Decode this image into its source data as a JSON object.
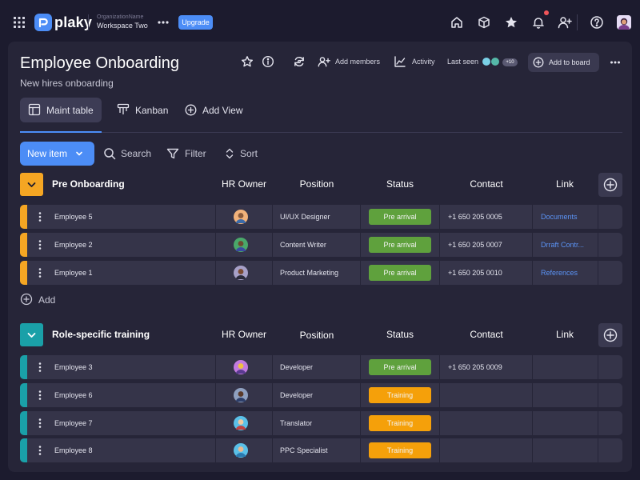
{
  "topbar": {
    "logo": "plaky",
    "organization": "OrganizationName",
    "workspace": "Workspace Two",
    "upgrade_label": "Upgrade",
    "icons": [
      "apps-grid-icon",
      "home-icon",
      "box-icon",
      "star-icon",
      "bell-icon",
      "add-user-icon",
      "help-icon"
    ]
  },
  "board": {
    "title": "Employee Onboarding",
    "subtitle": "New hires onboarding",
    "add_members_label": "Add members",
    "activity_label": "Activity",
    "last_seen_label": "Last seen",
    "last_seen_more": "+10",
    "add_to_board_label": "Add to board"
  },
  "tabs": [
    {
      "label": "Maint table",
      "active": true
    },
    {
      "label": "Kanban",
      "active": false
    },
    {
      "label": "Add View",
      "active": false
    }
  ],
  "toolbar": {
    "new_item_label": "New item",
    "search_label": "Search",
    "filter_label": "Filter",
    "sort_label": "Sort"
  },
  "columns": [
    "HR Owner",
    "Position",
    "Status",
    "Contact",
    "Link"
  ],
  "groups": [
    {
      "name": "Pre Onboarding",
      "color": "#f5a623",
      "add_label": "Add",
      "rows": [
        {
          "name": "Employee 5",
          "position": "UI/UX Designer",
          "status": "Pre arrival",
          "contact": "+1 650 205 0005",
          "link": "Documents"
        },
        {
          "name": "Employee 2",
          "position": "Content Writer",
          "status": "Pre arrival",
          "contact": "+1 650 205 0007",
          "link": "Drraft Contr..."
        },
        {
          "name": "Employee 1",
          "position": "Product Marketing",
          "status": "Pre arrival",
          "contact": "+1 650 205 0010",
          "link": "References"
        }
      ]
    },
    {
      "name": "Role-specific training",
      "color": "#1aa0a8",
      "rows": [
        {
          "name": "Employee 3",
          "position": "Developer",
          "status": "Pre arrival",
          "contact": "+1 650 205 0009",
          "link": ""
        },
        {
          "name": "Employee 6",
          "position": "Developer",
          "status": "Training",
          "contact": "",
          "link": ""
        },
        {
          "name": "Employee 7",
          "position": "Translator",
          "status": "Training",
          "contact": "",
          "link": ""
        },
        {
          "name": "Employee 8",
          "position": "PPC Specialist",
          "status": "Training",
          "contact": "",
          "link": ""
        }
      ]
    }
  ],
  "status_colors": {
    "Pre arrival": "#5fa13d",
    "Training": "#f5a00a"
  },
  "colors": {
    "accent": "#4c8df6",
    "background": "#1c1b2e",
    "panel": "#262538",
    "row": "#353449"
  }
}
